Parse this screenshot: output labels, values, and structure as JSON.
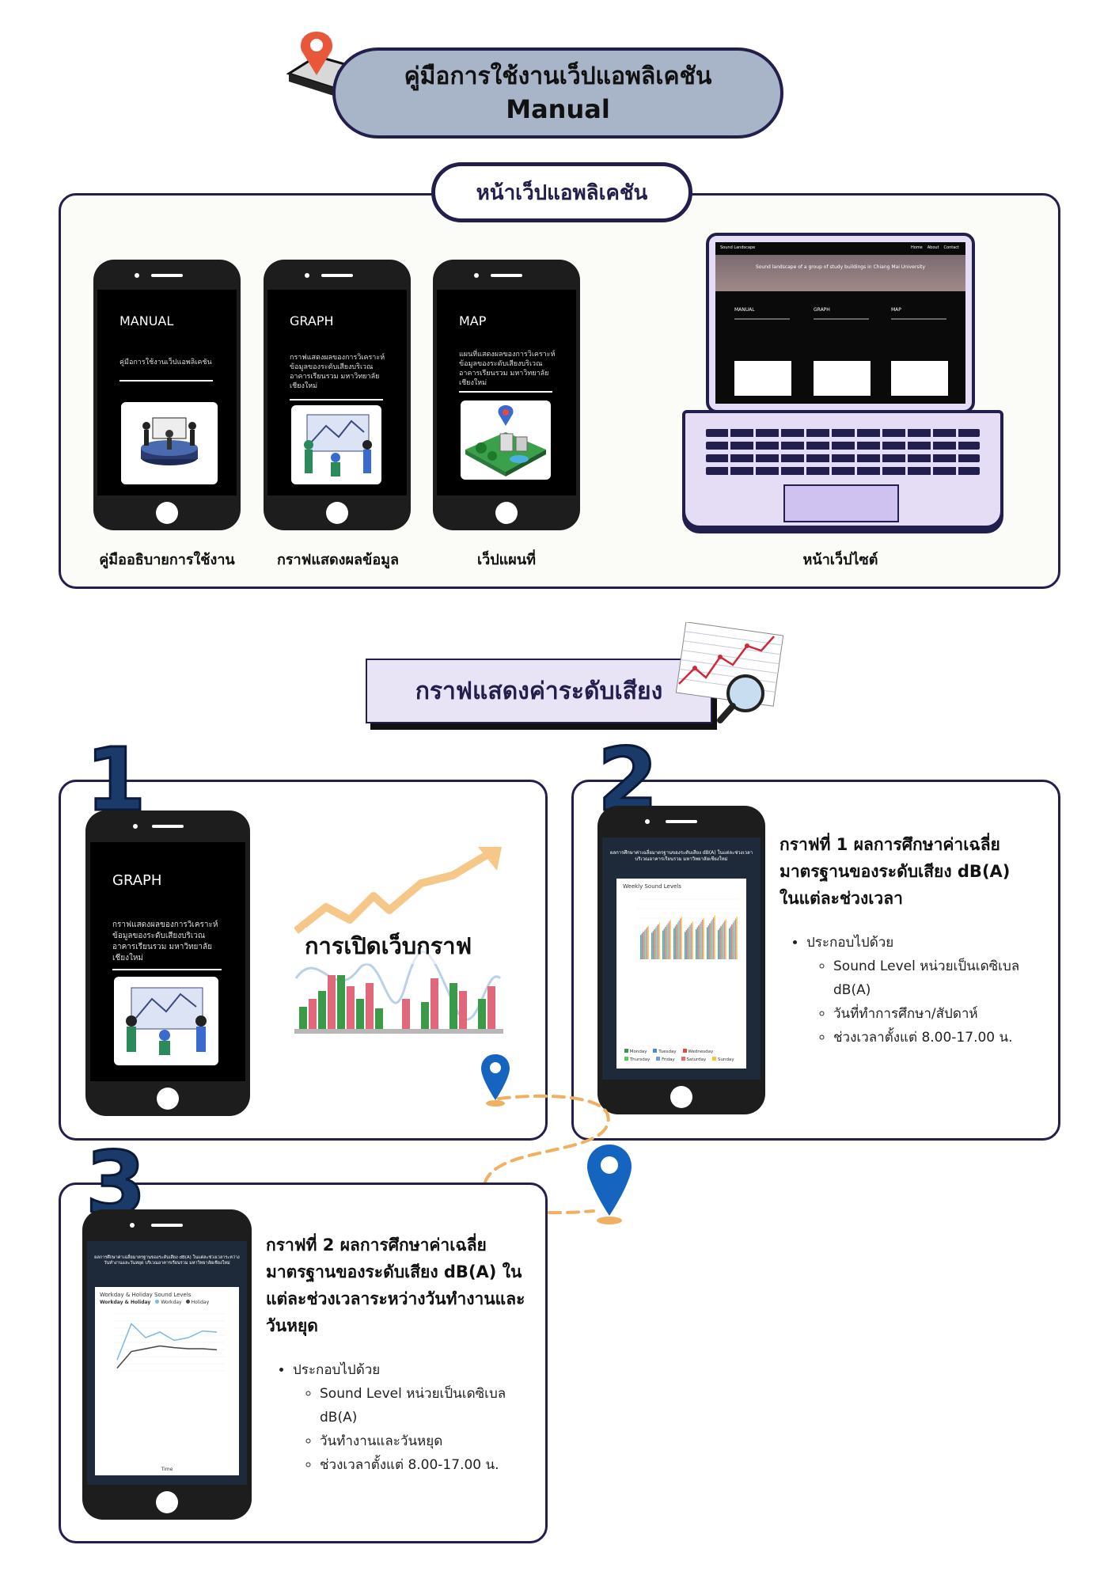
{
  "header": {
    "title_th": "คู่มือการใช้งานเว็ปแอพลิเคชัน",
    "title_en": "Manual"
  },
  "section_app": {
    "title": "หน้าเว็ปแอพลิเคชัน",
    "phones": [
      {
        "heading": "MANUAL",
        "text": "คู่มือการใช้งานเว็ปแอพลิเคชัน",
        "caption": "คู่มืออธิบายการใช้งาน"
      },
      {
        "heading": "GRAPH",
        "text": "กราฟแสดงผลของการวิเคราะห์ข้อมูลของระดับเสียงบริเวณอาคารเรียนรวม มหาวิทยาลัยเชียงใหม่",
        "caption": "กราฟแสดงผลข้อมูล"
      },
      {
        "heading": "MAP",
        "text": "แผนที่แสดงผลของการวิเคราะห์ข้อมูลของระดับเสียงบริเวณอาคารเรียนรวม มหาวิทยาลัยเชียงใหม่",
        "caption": "เว็ปแผนที่"
      }
    ],
    "laptop": {
      "site_name": "Sound Landscape",
      "nav": [
        "Home",
        "About",
        "Contact"
      ],
      "banner": "Sound landscape of a group of study buildings in Chiang Mai University",
      "cards": [
        "MANUAL",
        "GRAPH",
        "MAP"
      ],
      "caption": "หน้าเว็ปไซต์"
    }
  },
  "section_graph": {
    "title": "กราฟแสดงค่าระดับเสียง",
    "step1": {
      "number": "1",
      "phone_heading": "GRAPH",
      "phone_text": "กราฟแสดงผลของการวิเคราะห์ข้อมูลของระดับเสียงบริเวณอาคารเรียนรวม มหาวิทยาลัยเชียงใหม่",
      "label": "การเปิดเว็บกราฟ"
    },
    "step2": {
      "number": "2",
      "screen_title": "ผลการศึกษาค่าเฉลี่ยมาตรฐานของระดับเสียง dB(A) ในแต่ละช่วงเวลาบริเวณอาคารเรียนรวม มหาวิทยาลัยเชียงใหม่",
      "chart_title": "Weekly Sound Levels",
      "legend": [
        "Monday",
        "Tuesday",
        "Wednesday",
        "Thursday",
        "Friday",
        "Saturday",
        "Sunday"
      ],
      "desc_title": "กราฟที่ 1 ผลการศึกษาค่าเฉลี่ยมาตรฐานของระดับเสียง dB(A) ในแต่ละช่วงเวลา",
      "bullet": "ประกอบไปด้วย",
      "items": [
        "Sound Level หน่วยเป็นเดซิเบล dB(A)",
        "วันที่ทำการศึกษา/สัปดาห์",
        "ช่วงเวลาตั้งแต่ 8.00-17.00 น."
      ]
    },
    "step3": {
      "number": "3",
      "screen_title": "ผลการศึกษาค่าเฉลี่ยมาตรฐานของระดับเสียง dB(A) ในแต่ละช่วงเวลาระหว่างวันทำงานและวันหยุด บริเวณอาคารเรียนรวม มหาวิทยาลัยเชียงใหม่",
      "chart_title": "Workday & Holiday Sound Levels",
      "chart_sub": "Workday & Holiday",
      "legend": [
        "Workday",
        "Holiday"
      ],
      "xlabel": "Time",
      "desc_title": "กราฟที่ 2 ผลการศึกษาค่าเฉลี่ยมาตรฐานของระดับเสียง dB(A) ในแต่ละช่วงเวลาระหว่างวันทำงานและวันหยุด",
      "bullet": "ประกอบไปด้วย",
      "items": [
        "Sound Level หน่วยเป็นเดซิเบล dB(A)",
        "วันทำงานและวันหยุด",
        "ช่วงเวลาตั้งแต่ 8.00-17.00 น."
      ]
    }
  },
  "colors": {
    "navy": "#231f4c",
    "pill": "#a8b4c8",
    "lavender": "#e8e4f5",
    "pin_blue": "#1565c0",
    "dash_orange": "#f0b060"
  }
}
